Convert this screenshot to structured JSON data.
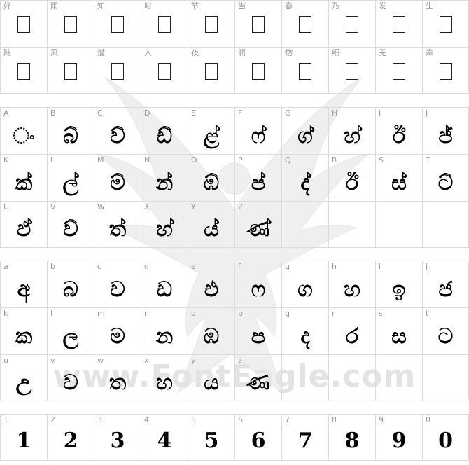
{
  "watermark": {
    "text": "www.FontEagle.com"
  },
  "chinese": {
    "rows": [
      [
        "好",
        "雨",
        "知",
        "时",
        "节",
        "当",
        "春",
        "乃",
        "发",
        "生"
      ],
      [
        "随",
        "风",
        "潜",
        "入",
        "夜",
        "润",
        "物",
        "细",
        "无",
        "声"
      ]
    ]
  },
  "uppercase": {
    "rows": [
      [
        {
          "k": "A",
          "g": "ං"
        },
        {
          "k": "B",
          "g": "බ්"
        },
        {
          "k": "C",
          "g": "ව්"
        },
        {
          "k": "D",
          "g": "ඩ්"
        },
        {
          "k": "E",
          "g": "ළ්"
        },
        {
          "k": "F",
          "g": "ෆ්"
        },
        {
          "k": "G",
          "g": "ග්"
        },
        {
          "k": "H",
          "g": "හ්"
        },
        {
          "k": "I",
          "g": "ඊ"
        },
        {
          "k": "J",
          "g": "ජ්"
        }
      ],
      [
        {
          "k": "K",
          "g": "ක්"
        },
        {
          "k": "L",
          "g": "ල්"
        },
        {
          "k": "M",
          "g": "ම්"
        },
        {
          "k": "N",
          "g": "න්"
        },
        {
          "k": "O",
          "g": "ඹ්"
        },
        {
          "k": "P",
          "g": "ප්"
        },
        {
          "k": "Q",
          "g": "ද්"
        },
        {
          "k": "R",
          "g": "ඊ"
        },
        {
          "k": "S",
          "g": "ස්"
        },
        {
          "k": "T",
          "g": "ට්"
        }
      ],
      [
        {
          "k": "U",
          "g": "ඵ්"
        },
        {
          "k": "V",
          "g": "ව්"
        },
        {
          "k": "W",
          "g": "ත්"
        },
        {
          "k": "X",
          "g": "හ්"
        },
        {
          "k": "Y",
          "g": "ය්"
        },
        {
          "k": "Z",
          "g": "ණ්"
        },
        {
          "k": "",
          "g": ""
        },
        {
          "k": "",
          "g": ""
        },
        {
          "k": "",
          "g": ""
        },
        {
          "k": "",
          "g": ""
        }
      ]
    ]
  },
  "lowercase": {
    "rows": [
      [
        {
          "k": "a",
          "g": "අ"
        },
        {
          "k": "b",
          "g": "බ"
        },
        {
          "k": "c",
          "g": "ච"
        },
        {
          "k": "d",
          "g": "ඩ"
        },
        {
          "k": "e",
          "g": "එ"
        },
        {
          "k": "f",
          "g": "ෆ"
        },
        {
          "k": "g",
          "g": "ග"
        },
        {
          "k": "h",
          "g": "හ"
        },
        {
          "k": "i",
          "g": "ඉ"
        },
        {
          "k": "j",
          "g": "ජ"
        }
      ],
      [
        {
          "k": "k",
          "g": "ක"
        },
        {
          "k": "l",
          "g": "ල"
        },
        {
          "k": "m",
          "g": "ම"
        },
        {
          "k": "n",
          "g": "න"
        },
        {
          "k": "o",
          "g": "ඹ"
        },
        {
          "k": "p",
          "g": "ප"
        },
        {
          "k": "q",
          "g": "ද"
        },
        {
          "k": "r",
          "g": "ර"
        },
        {
          "k": "s",
          "g": "ස"
        },
        {
          "k": "t",
          "g": "ට"
        }
      ],
      [
        {
          "k": "u",
          "g": "උ"
        },
        {
          "k": "v",
          "g": "ව"
        },
        {
          "k": "w",
          "g": "ත"
        },
        {
          "k": "x",
          "g": "හ"
        },
        {
          "k": "y",
          "g": "ය"
        },
        {
          "k": "z",
          "g": "ණ"
        },
        {
          "k": "",
          "g": ""
        },
        {
          "k": "",
          "g": ""
        },
        {
          "k": "",
          "g": ""
        },
        {
          "k": "",
          "g": ""
        }
      ]
    ]
  },
  "numbers": {
    "row": [
      {
        "k": "1",
        "g": "1"
      },
      {
        "k": "2",
        "g": "2"
      },
      {
        "k": "3",
        "g": "3"
      },
      {
        "k": "4",
        "g": "4"
      },
      {
        "k": "5",
        "g": "5"
      },
      {
        "k": "6",
        "g": "6"
      },
      {
        "k": "7",
        "g": "7"
      },
      {
        "k": "8",
        "g": "8"
      },
      {
        "k": "9",
        "g": "9"
      },
      {
        "k": "0",
        "g": "0"
      }
    ]
  }
}
